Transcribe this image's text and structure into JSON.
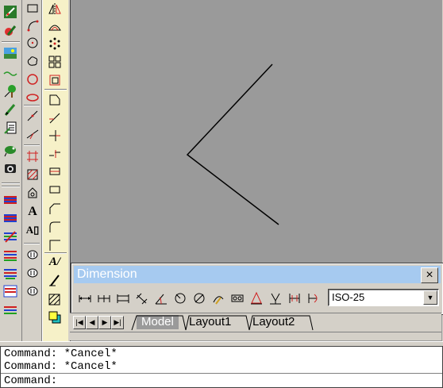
{
  "left_toolbar": {
    "icons": [
      "edit-pen-icon",
      "draw-pencil-icon",
      "image-icon",
      "wave-line-icon",
      "tree-icon",
      "pen-icon",
      "document-icon",
      "bird-icon",
      "camera-icon",
      "layers-icon",
      "layers-icon",
      "layers-icon",
      "layers-icon",
      "layers-icon",
      "layers-icon"
    ]
  },
  "draw_toolbar": {
    "icons": [
      "rectangle-icon",
      "arc-icon",
      "circle-icon",
      "revcloud-icon",
      "circle-icon",
      "ellipse-icon",
      "point-icon",
      "xline-icon",
      "table-icon",
      "hatch-icon",
      "region-icon",
      "multiline-text-icon",
      "text-icon",
      "wipeout-icon",
      "ellipse-icon",
      "field-icon"
    ]
  },
  "modify_toolbar": {
    "icons": [
      "mirror-icon",
      "offset-icon",
      "array-icon",
      "array-rect-icon",
      "scale-icon",
      "stretch-icon",
      "trim-icon",
      "extend-icon",
      "break-icon",
      "join-icon",
      "chamfer-icon",
      "fillet-icon",
      "explode-icon",
      "text-style-icon",
      "pen-edit-icon",
      "hatch-edit-icon",
      "layer-color-icon"
    ]
  },
  "dimension_toolbar": {
    "title": "Dimension",
    "close_label": "×",
    "icons": [
      "linear-dim-icon",
      "baseline-dim-icon",
      "continue-dim-icon",
      "aligned-dim-icon",
      "angular-dim-icon",
      "radius-dim-icon",
      "diameter-dim-icon",
      "arc-length-icon",
      "ordinate-dim-icon",
      "tolerance-icon",
      "center-mark-icon",
      "quick-leader-icon",
      "dim-edit-icon",
      "dim-update-icon"
    ],
    "style_select": {
      "value": "ISO-25"
    }
  },
  "layout_tabs": {
    "nav": [
      "|◀",
      "◀",
      "▶",
      "▶|"
    ],
    "tabs": [
      {
        "label": "Model",
        "active": true
      },
      {
        "label": "Layout1",
        "active": false
      },
      {
        "label": "Layout2",
        "active": false
      }
    ]
  },
  "command_window": {
    "history": [
      "Command: *Cancel*",
      "Command: *Cancel*"
    ],
    "prompt": "Command:"
  },
  "colors": {
    "canvas": "#9a9a9a",
    "titlebar": "#a6caf0",
    "toolbar": "#d4d0c8",
    "modify_bg": "#f6f1c8"
  }
}
